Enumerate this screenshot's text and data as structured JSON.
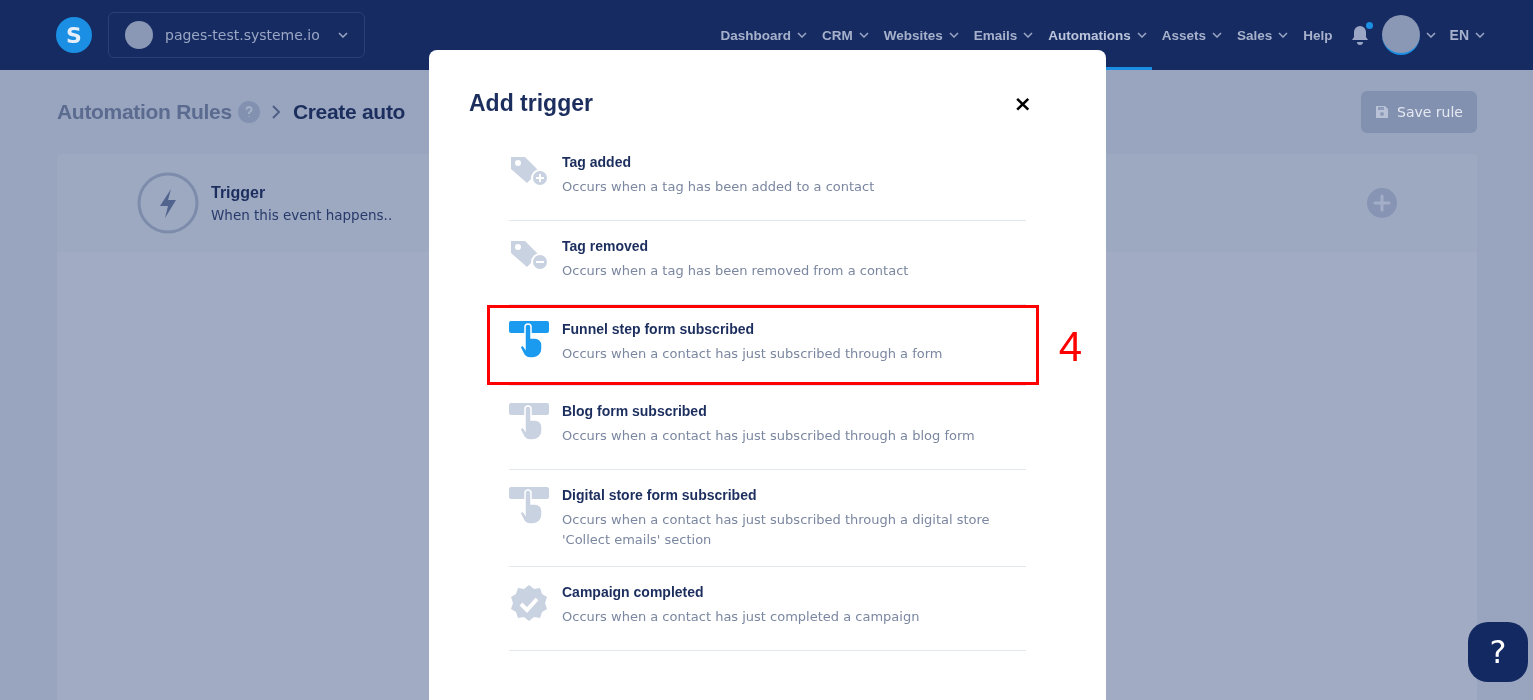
{
  "header": {
    "site": "pages-test.systeme.io",
    "logo": "S",
    "nav": [
      {
        "label": "Dashboard",
        "dropdown": true,
        "selected": false
      },
      {
        "label": "CRM",
        "dropdown": true,
        "selected": false
      },
      {
        "label": "Websites",
        "dropdown": true,
        "selected": false
      },
      {
        "label": "Emails",
        "dropdown": true,
        "selected": false
      },
      {
        "label": "Automations",
        "dropdown": true,
        "selected": true
      },
      {
        "label": "Assets",
        "dropdown": true,
        "selected": false
      },
      {
        "label": "Sales",
        "dropdown": true,
        "selected": false
      },
      {
        "label": "Help",
        "dropdown": false,
        "selected": false
      }
    ],
    "notifications_unread": true,
    "language": "EN"
  },
  "breadcrumb": [
    "Automation Rules",
    "Create auto"
  ],
  "save_button": "Save rule",
  "trigger_card": {
    "title": "Trigger",
    "subtitle": "When this event happens.."
  },
  "help_button": "?",
  "modal": {
    "title": "Add trigger",
    "close": "×",
    "items": [
      {
        "kind": "tag-add",
        "title": "Tag added",
        "description": "Occurs when a tag has been added to a contact",
        "highlighted": false
      },
      {
        "kind": "tag-remove",
        "title": "Tag removed",
        "description": "Occurs when a tag has been removed from a contact",
        "highlighted": false
      },
      {
        "kind": "form-click",
        "title": "Funnel step form subscribed",
        "description": "Occurs when a contact has just subscribed through a form",
        "highlighted": true,
        "callout": "4"
      },
      {
        "kind": "form-click",
        "title": "Blog form subscribed",
        "description": "Occurs when a contact has just subscribed through a blog form",
        "highlighted": false
      },
      {
        "kind": "form-click",
        "title": "Digital store form subscribed",
        "description": "Occurs when a contact has just subscribed through a digital store 'Collect emails' section",
        "highlighted": false
      },
      {
        "kind": "badge-check",
        "title": "Campaign completed",
        "description": "Occurs when a contact has just completed a campaign",
        "highlighted": false
      }
    ]
  }
}
